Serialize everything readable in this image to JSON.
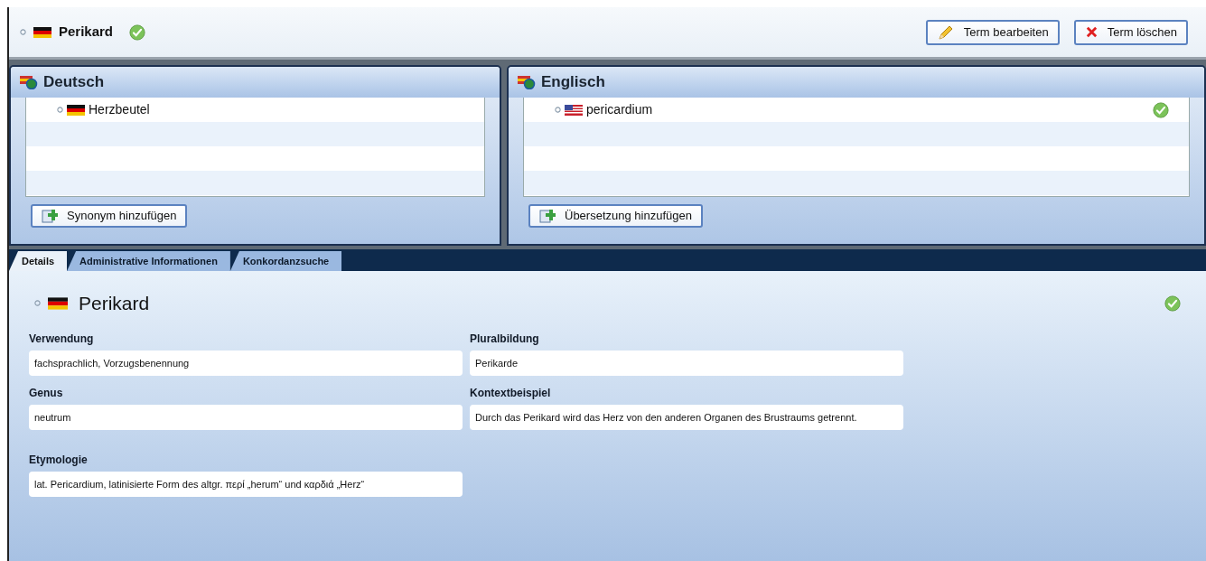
{
  "header": {
    "term": "Perikard",
    "flag": {
      "kind": "de"
    },
    "approved": true,
    "buttons": [
      {
        "kind": "edit",
        "label": "Term bearbeiten"
      },
      {
        "kind": "delete",
        "label": "Term löschen"
      }
    ]
  },
  "languages": [
    {
      "name": "Deutsch",
      "button": "Synonym hinzufügen",
      "terms": [
        {
          "text": "Herzbeutel",
          "flag": {
            "kind": "de"
          },
          "approved": false
        }
      ]
    },
    {
      "name": "Englisch",
      "button": "Übersetzung hinzufügen",
      "terms": [
        {
          "text": "pericardium",
          "flag": {
            "kind": "us"
          },
          "approved": true
        }
      ]
    }
  ],
  "tabs": [
    {
      "label": "Details",
      "selected": true
    },
    {
      "label": "Administrative Informationen",
      "selected": false
    },
    {
      "label": "Konkordanzsuche",
      "selected": false
    }
  ],
  "details": {
    "term": "Perikard",
    "flag": {
      "kind": "de"
    },
    "approved": true,
    "left_fields": [
      {
        "label": "Verwendung",
        "value": "fachsprachlich, Vorzugsbenennung"
      },
      {
        "label": "Genus",
        "value": "neutrum"
      },
      {
        "label": "Etymologie",
        "value": "lat. Pericardium, latinisierte Form des altgr. περί „herum“ und καρδιά „Herz“"
      }
    ],
    "right_fields": [
      {
        "label": "Pluralbildung",
        "value": "Perikarde"
      },
      {
        "label": "Kontextbeispiel",
        "value": "Durch das Perikard wird das Herz von den anderen Organen des Brustraums getrennt."
      }
    ]
  }
}
